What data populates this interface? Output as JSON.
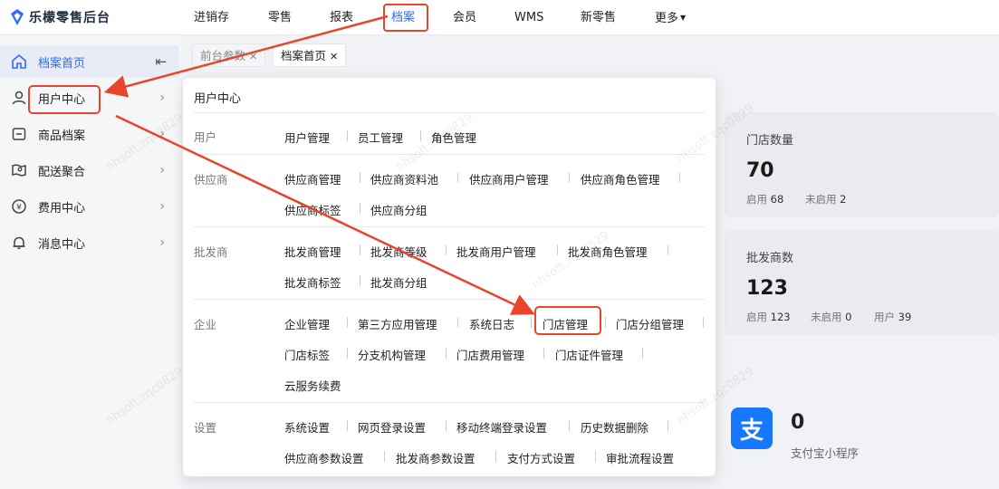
{
  "app": {
    "title": "乐檬零售后台"
  },
  "topnav": [
    {
      "label": "进销存"
    },
    {
      "label": "零售"
    },
    {
      "label": "报表"
    },
    {
      "label": "档案"
    },
    {
      "label": "会员"
    },
    {
      "label": "WMS"
    },
    {
      "label": "新零售"
    },
    {
      "label": "更多"
    }
  ],
  "sidebar": {
    "items": [
      {
        "label": "档案首页",
        "icon": "home-icon"
      },
      {
        "label": "用户中心",
        "icon": "user-icon"
      },
      {
        "label": "商品档案",
        "icon": "box-icon"
      },
      {
        "label": "配送聚合",
        "icon": "map-icon"
      },
      {
        "label": "费用中心",
        "icon": "yuan-icon"
      },
      {
        "label": "消息中心",
        "icon": "bell-icon"
      }
    ]
  },
  "tabs": [
    {
      "label": "前台参数"
    },
    {
      "label": "档案首页"
    }
  ],
  "cards": {
    "stores": {
      "title": "门店数量",
      "count": "70",
      "enabled_label": "启用",
      "enabled": "68",
      "disabled_label": "未启用",
      "disabled": "2"
    },
    "wholesalers": {
      "title": "批发商数",
      "count": "123",
      "enabled_label": "启用",
      "enabled": "123",
      "disabled_label": "未启用",
      "disabled": "0",
      "users_label": "用户",
      "users": "39"
    },
    "alipay": {
      "count": "0",
      "label": "支付宝小程序",
      "icon_glyph": "支"
    }
  },
  "panel": {
    "title": "用户中心",
    "groups": [
      {
        "label": "用户",
        "links": [
          "用户管理",
          "员工管理",
          "角色管理"
        ]
      },
      {
        "label": "供应商",
        "links": [
          "供应商管理",
          "供应商资料池",
          "供应商用户管理",
          "供应商角色管理",
          "供应商标签",
          "供应商分组"
        ]
      },
      {
        "label": "批发商",
        "links": [
          "批发商管理",
          "批发商等级",
          "批发商用户管理",
          "批发商角色管理",
          "批发商标签",
          "批发商分组"
        ]
      },
      {
        "label": "企业",
        "links": [
          "企业管理",
          "第三方应用管理",
          "系统日志",
          "门店管理",
          "门店分组管理",
          "门店标签",
          "分支机构管理",
          "门店费用管理",
          "门店证件管理",
          "云服务续费"
        ]
      },
      {
        "label": "设置",
        "links": [
          "系统设置",
          "网页登录设置",
          "移动终端登录设置",
          "历史数据删除",
          "供应商参数设置",
          "批发商参数设置",
          "支付方式设置",
          "审批流程设置"
        ]
      }
    ]
  },
  "watermark": "nhsoft.zqc0829",
  "colors": {
    "accent": "#2f6bff",
    "annotation": "#e8452d",
    "alipay": "#1677ff"
  }
}
